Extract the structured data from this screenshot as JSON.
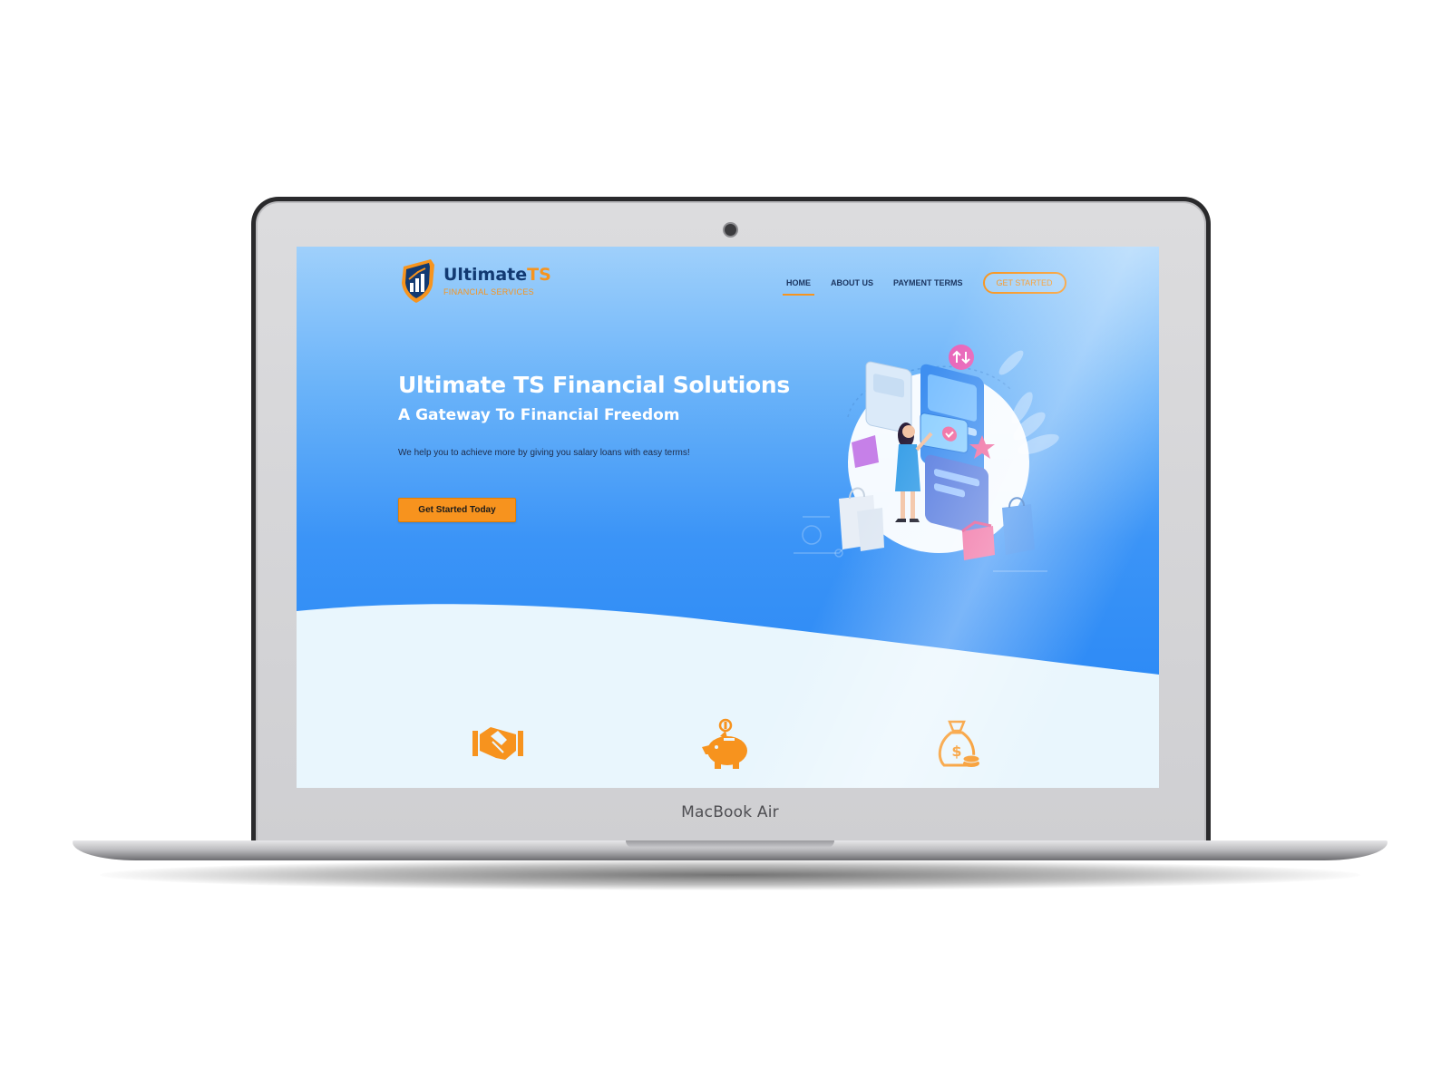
{
  "device": {
    "label": "MacBook Air"
  },
  "site": {
    "logo": {
      "name_main": "Ultimate",
      "name_accent": "TS",
      "tagline": "FINANCIAL SERVICES"
    },
    "nav": {
      "items": [
        {
          "label": "HOME",
          "active": true
        },
        {
          "label": "ABOUT US",
          "active": false
        },
        {
          "label": "PAYMENT TERMS",
          "active": false
        }
      ],
      "cta_label": "GET STARTED"
    },
    "hero": {
      "title": "Ultimate TS Financial Solutions",
      "subtitle": "A Gateway To Financial Freedom",
      "text": "We help you to achieve more by giving you salary loans with easy terms!",
      "button_label": "Get Started Today"
    },
    "features": {
      "icons": [
        "handshake-icon",
        "piggy-bank-icon",
        "money-bag-icon"
      ]
    }
  },
  "colors": {
    "accent": "#f7941d",
    "navy": "#123a72",
    "hero_blue": "#2a88f5",
    "light_section": "#e9f6fd"
  }
}
